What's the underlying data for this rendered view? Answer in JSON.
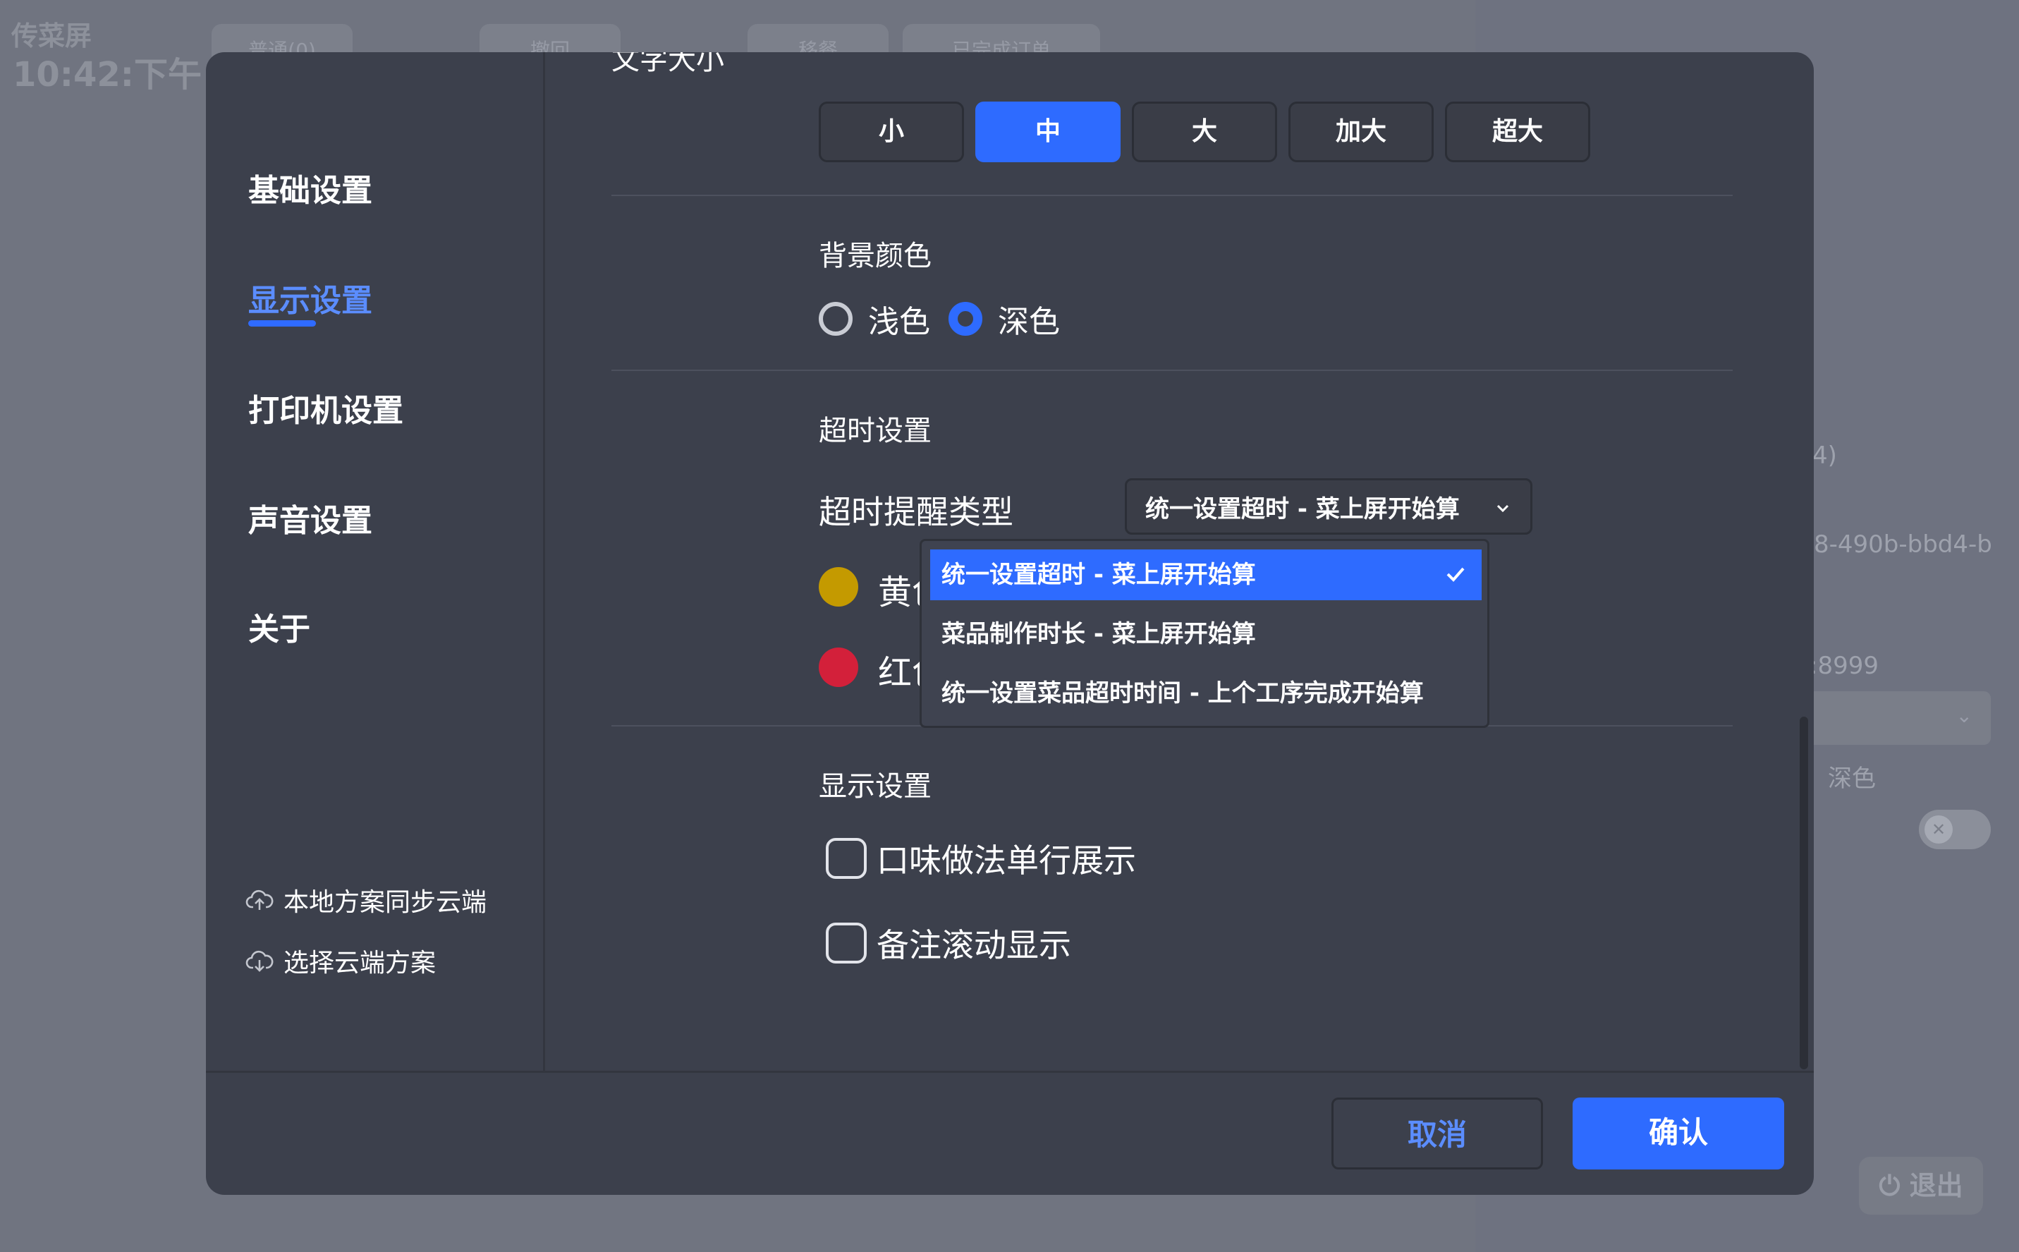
{
  "background": {
    "app_title": "传菜屏",
    "time": "10:42:下午",
    "toolbar": [
      "普通(0)",
      "撤回",
      "移餐",
      "已完成订单"
    ],
    "right_panel": {
      "text_1": "4)",
      "text_2": "8-490b-bbd4-b",
      "text_3": ":8999",
      "text_4": "深色",
      "logout_label": "退出"
    }
  },
  "sidebar": {
    "items": [
      {
        "label": "基础设置",
        "active": false
      },
      {
        "label": "显示设置",
        "active": true
      },
      {
        "label": "打印机设置",
        "active": false
      },
      {
        "label": "声音设置",
        "active": false
      },
      {
        "label": "关于",
        "active": false
      }
    ],
    "links": [
      {
        "label": "本地方案同步云端",
        "icon": "cloud-upload-icon"
      },
      {
        "label": "选择云端方案",
        "icon": "cloud-download-icon"
      }
    ]
  },
  "settings": {
    "font_size": {
      "title": "文字大小",
      "options": [
        "小",
        "中",
        "大",
        "加大",
        "超大"
      ],
      "selected": "中"
    },
    "background_color": {
      "title": "背景颜色",
      "options": [
        "浅色",
        "深色"
      ],
      "selected": "深色"
    },
    "timeout": {
      "title": "超时设置",
      "type_label": "超时提醒类型",
      "type_value": "统一设置超时 - 菜上屏开始算",
      "yellow_label": "黄色超时时间",
      "red_label": "红色超时时间",
      "dropdown_options": [
        "统一设置超时 - 菜上屏开始算",
        "菜品制作时长 - 菜上屏开始算",
        "统一设置菜品超时时间 - 上个工序完成开始算"
      ],
      "dropdown_selected": "统一设置超时 - 菜上屏开始算"
    },
    "display": {
      "title": "显示设置",
      "options": [
        {
          "label": "口味做法单行展示",
          "checked": false
        },
        {
          "label": "备注滚动显示",
          "checked": false
        }
      ]
    }
  },
  "footer": {
    "cancel_label": "取消",
    "confirm_label": "确认"
  },
  "colors": {
    "accent": "#2e6bff",
    "dialog_bg": "#3c404c",
    "yellow_timeout": "#c49a00",
    "red_timeout": "#d3203a"
  }
}
